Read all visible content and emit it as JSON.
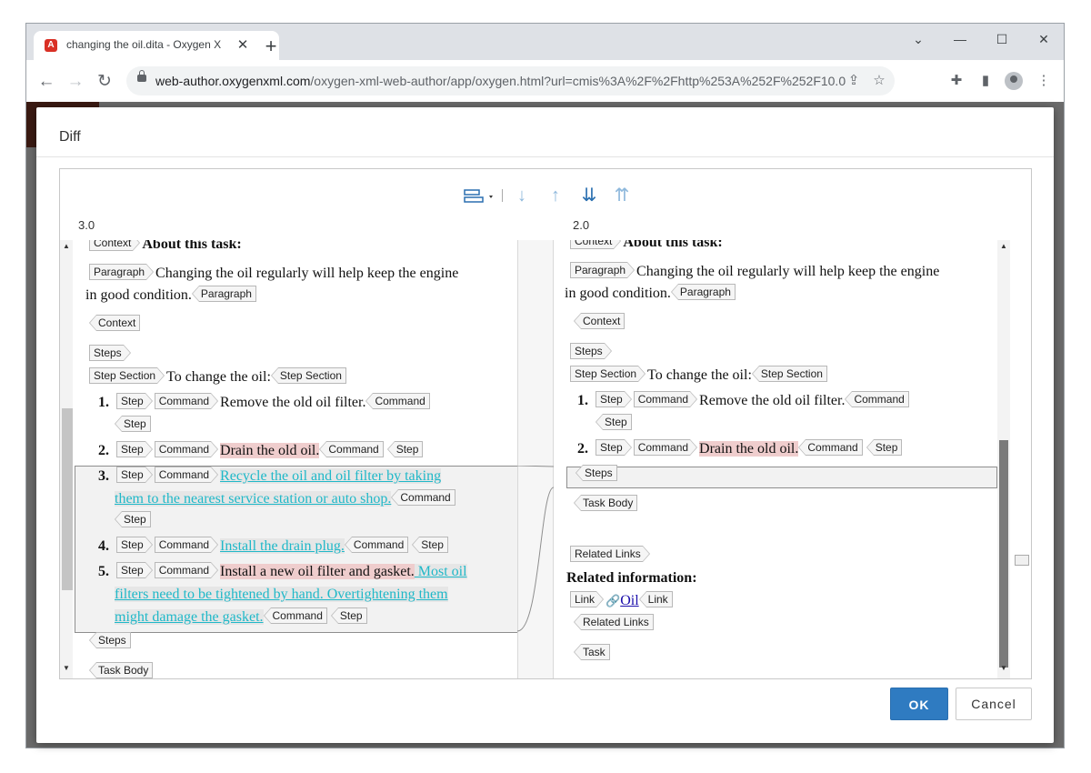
{
  "browser": {
    "tab_title": "changing the oil.dita - Oxygen X",
    "tab_close": "✕",
    "new_tab": "+",
    "window_controls": {
      "minimize": "—",
      "maximize": "☐",
      "close": "✕",
      "dropdown": "⌄"
    },
    "url_host": "web-author.oxygenxml.com",
    "url_path": "/oxygen-xml-web-author/app/oxygen.html?url=cmis%3A%2F%2Fhttp%253A%252F%252F10.0.0.9...",
    "icons": [
      "back-icon",
      "forward-icon",
      "reload-icon",
      "lock-icon",
      "share-icon",
      "star-icon",
      "extensions-icon",
      "side-panel-icon",
      "profile-icon",
      "menu-icon"
    ]
  },
  "dialog": {
    "title": "Diff",
    "ok_label": "OK",
    "cancel_label": "Cancel",
    "toolbar_icons": [
      "layout-icon",
      "next-change-icon",
      "previous-change-icon",
      "last-change-icon",
      "first-change-icon"
    ],
    "left_version": "3.0",
    "right_version": "2.0"
  },
  "tags": {
    "context": "Context",
    "paragraph": "Paragraph",
    "steps": "Steps",
    "step_section": "Step Section",
    "step": "Step",
    "command": "Command",
    "task_body": "Task Body",
    "related_links": "Related Links",
    "link": "Link",
    "task": "Task"
  },
  "left": {
    "about": "About this task:",
    "para_text_1": "Changing the oil regularly will help keep the engine",
    "para_text_2": "in good condition.",
    "step_section_text": "To change the oil:",
    "step1_num": "1.",
    "step1_text": "Remove the old oil filter.",
    "step2_num": "2.",
    "step2_text": "Drain the old oil.",
    "step3_num": "3.",
    "step3_text_1": "Recycle the oil and oil filter by taking",
    "step3_text_2": "them to the nearest service station or auto shop.",
    "step4_num": "4.",
    "step4_text": "Install the drain plug.",
    "step5_num": "5.",
    "step5_text_a": "Install a new oil filter and gasket.",
    "step5_text_b": " Most oil",
    "step5_text_c": "filters need to be tightened by hand. Overtightening them",
    "step5_text_d": "might damage the gasket."
  },
  "right": {
    "about": "About this task:",
    "para_text_1": "Changing the oil regularly will help keep the engine",
    "para_text_2": "in good condition.",
    "step_section_text": "To change the oil:",
    "step1_num": "1.",
    "step1_text": "Remove the old oil filter.",
    "step2_num": "2.",
    "step2_text": "Drain the old oil.",
    "related_info": "Related information:",
    "link_text": "Oil"
  },
  "colors": {
    "deleted_bg": "#efcdcd",
    "inserted_text": "#1fb8c8",
    "ok_button": "#2f7bc1",
    "toolbar_dark": "#2a6fb0",
    "toolbar_light": "#8eb8dc"
  }
}
